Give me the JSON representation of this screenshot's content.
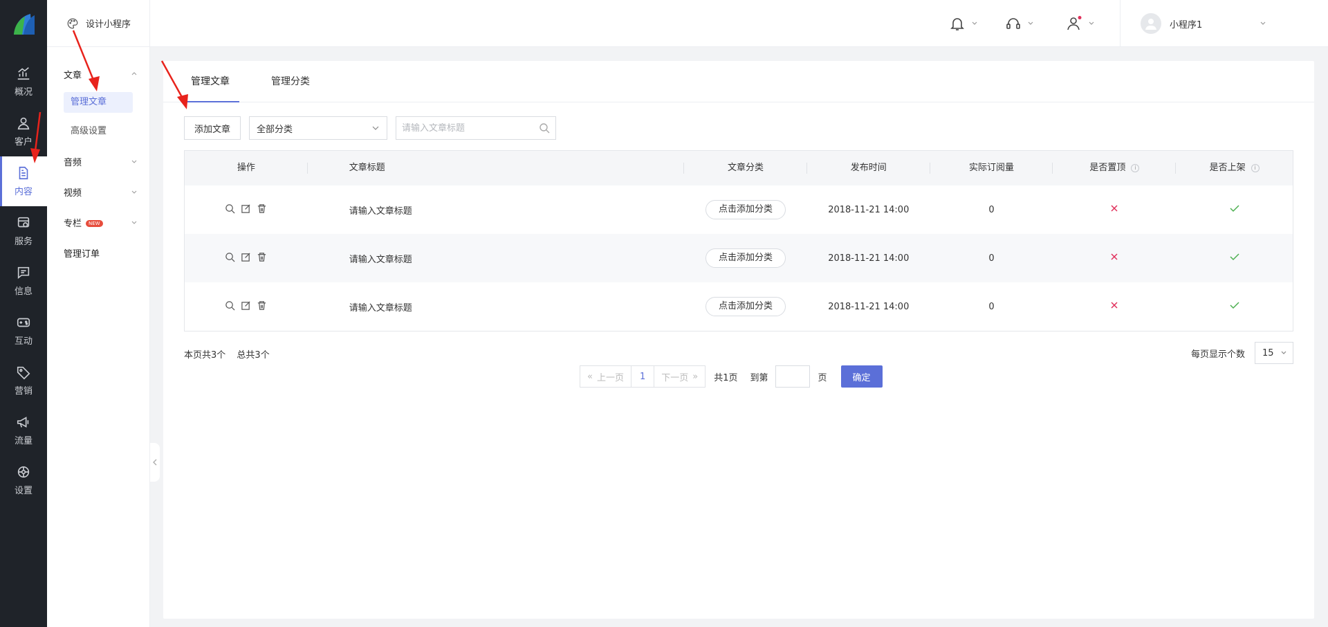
{
  "nav": {
    "items": [
      {
        "label": "概况",
        "icon": "chart-icon"
      },
      {
        "label": "客户",
        "icon": "user-icon"
      },
      {
        "label": "内容",
        "icon": "document-icon",
        "active": true
      },
      {
        "label": "服务",
        "icon": "service-icon"
      },
      {
        "label": "信息",
        "icon": "message-icon"
      },
      {
        "label": "互动",
        "icon": "gamepad-icon"
      },
      {
        "label": "营销",
        "icon": "tag-icon"
      },
      {
        "label": "流量",
        "icon": "megaphone-icon"
      },
      {
        "label": "设置",
        "icon": "gear-icon"
      }
    ]
  },
  "subnav": {
    "header": "设计小程序",
    "groups": {
      "article": "文章",
      "audio": "音频",
      "video": "视频",
      "column": "专栏",
      "column_badge": "NEW",
      "orders": "管理订单"
    },
    "article_items": [
      "管理文章",
      "高级设置"
    ]
  },
  "topbar": {
    "username": "小程序1"
  },
  "tabs": [
    "管理文章",
    "管理分类"
  ],
  "toolbar": {
    "add_label": "添加文章",
    "category_select": "全部分类",
    "search_placeholder": "请输入文章标题"
  },
  "table": {
    "headers": {
      "op": "操作",
      "title": "文章标题",
      "category": "文章分类",
      "time": "发布时间",
      "reads": "实际订阅量",
      "pinned": "是否置顶",
      "shelved": "是否上架"
    },
    "rows": [
      {
        "title": "请输入文章标题",
        "category_btn": "点击添加分类",
        "time": "2018-11-21 14:00",
        "reads": "0",
        "pinned": false,
        "shelved": true
      },
      {
        "title": "请输入文章标题",
        "category_btn": "点击添加分类",
        "time": "2018-11-21 14:00",
        "reads": "0",
        "pinned": false,
        "shelved": true
      },
      {
        "title": "请输入文章标题",
        "category_btn": "点击添加分类",
        "time": "2018-11-21 14:00",
        "reads": "0",
        "pinned": false,
        "shelved": true
      }
    ]
  },
  "summary": {
    "page_count": "本页共3个",
    "total_count": "总共3个"
  },
  "pagination": {
    "prev": "上一页",
    "current": "1",
    "next": "下一页",
    "total_pages": "共1页",
    "goto": "到第",
    "page_unit": "页",
    "confirm": "确定",
    "per_page_label": "每页显示个数",
    "per_page_value": "15"
  },
  "colors": {
    "accent": "#5b6fd8",
    "nav_bg": "#1f2329",
    "cross": "#e0305b",
    "check": "#4caf50",
    "annotation_arrow": "#e8231c"
  }
}
